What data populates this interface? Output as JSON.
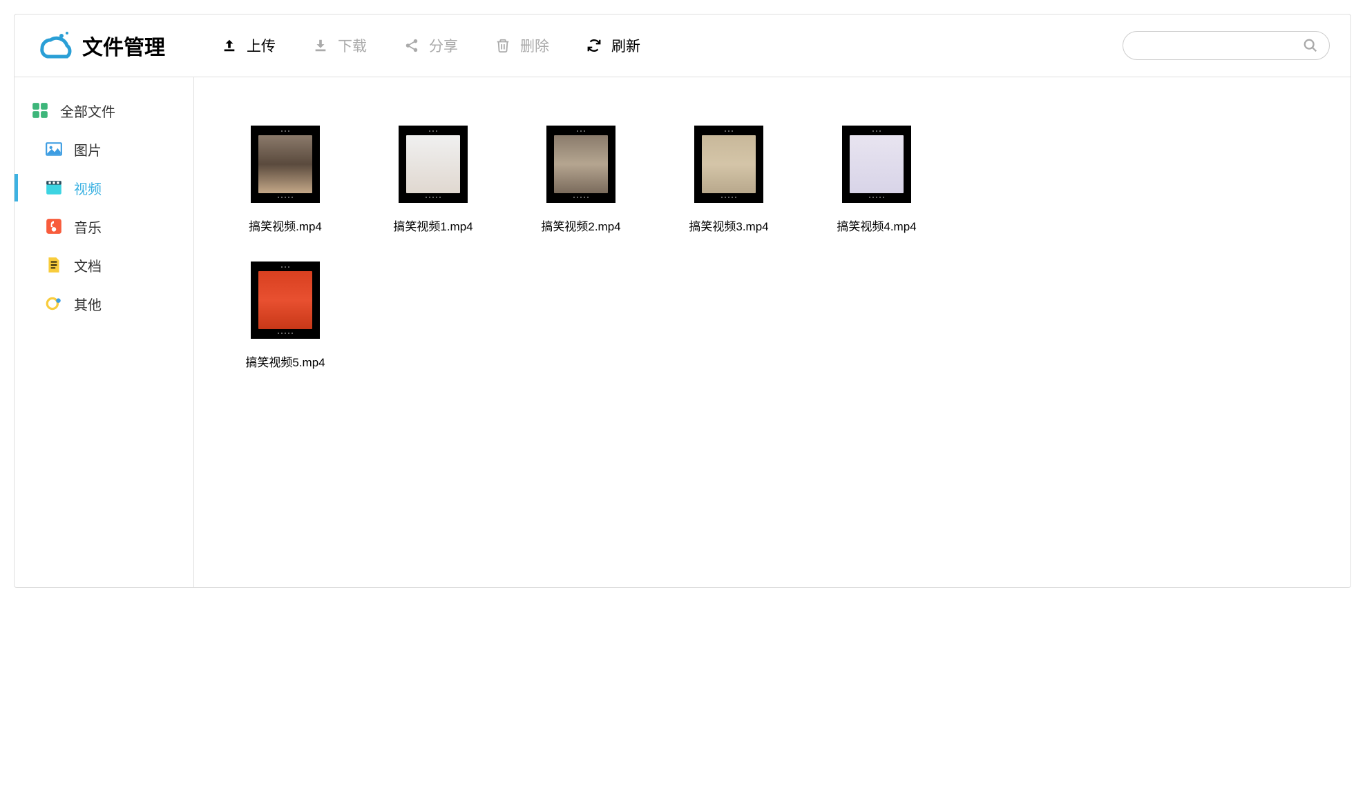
{
  "app": {
    "title": "文件管理"
  },
  "toolbar": {
    "upload_label": "上传",
    "download_label": "下载",
    "share_label": "分享",
    "delete_label": "删除",
    "refresh_label": "刷新"
  },
  "search": {
    "placeholder": ""
  },
  "sidebar": {
    "items": [
      {
        "label": "全部文件",
        "icon": "apps"
      },
      {
        "label": "图片",
        "icon": "image"
      },
      {
        "label": "视频",
        "icon": "video"
      },
      {
        "label": "音乐",
        "icon": "music"
      },
      {
        "label": "文档",
        "icon": "document"
      },
      {
        "label": "其他",
        "icon": "other"
      }
    ],
    "active_index": 2
  },
  "files": [
    {
      "name": "搞笑视频.mp4"
    },
    {
      "name": "搞笑视频1.mp4"
    },
    {
      "name": "搞笑视频2.mp4"
    },
    {
      "name": "搞笑视频3.mp4"
    },
    {
      "name": "搞笑视频4.mp4"
    },
    {
      "name": "搞笑视频5.mp4"
    }
  ]
}
